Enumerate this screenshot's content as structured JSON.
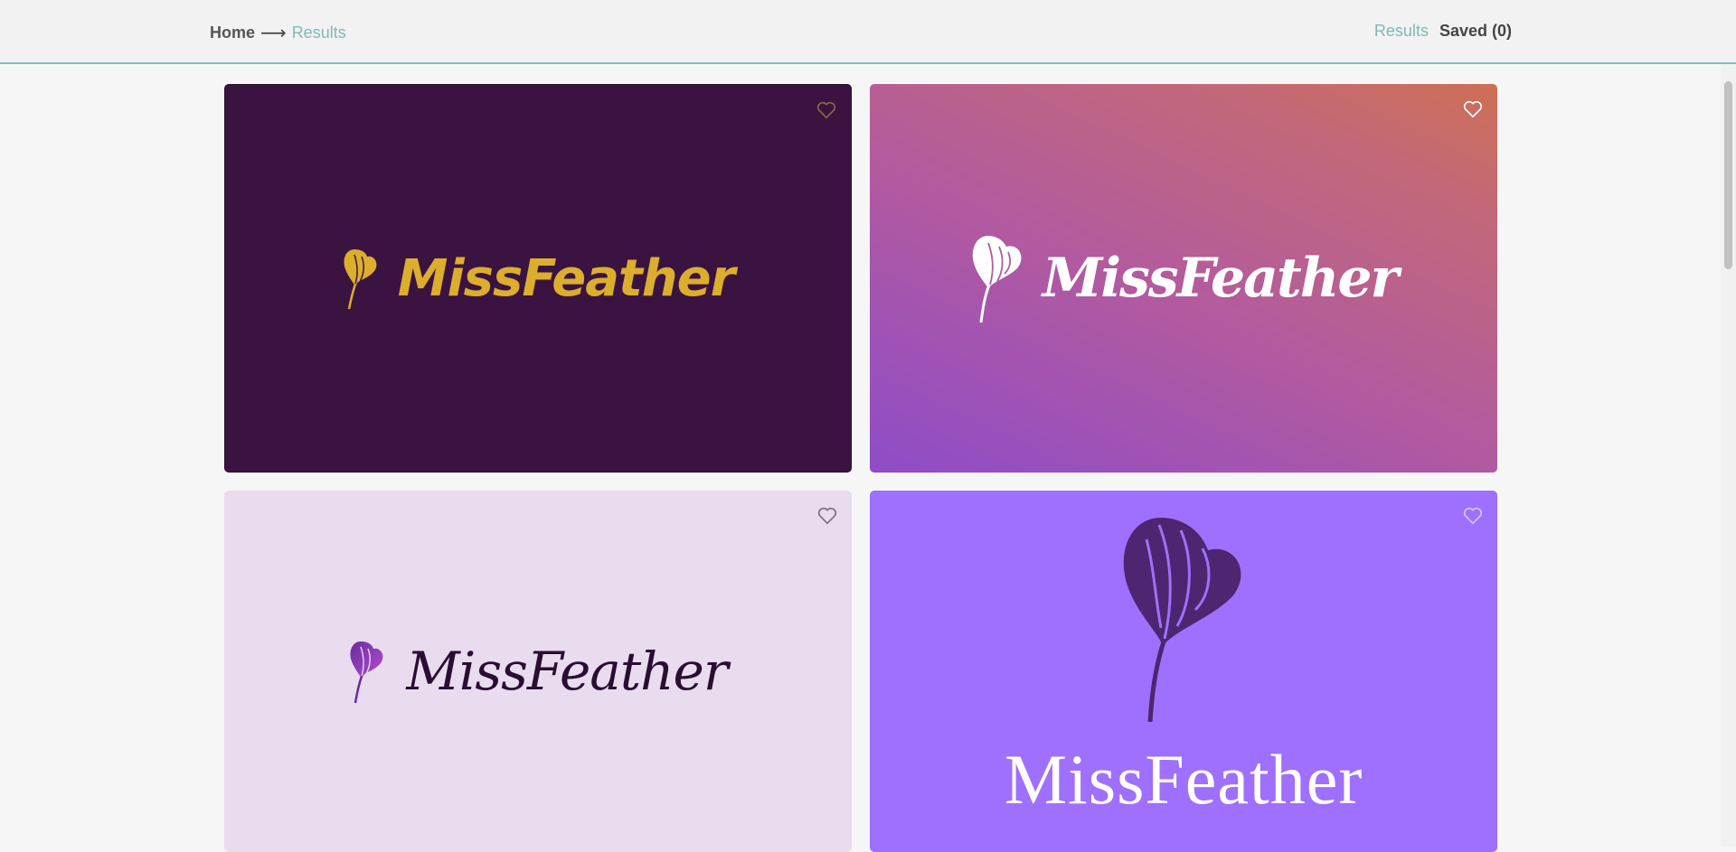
{
  "breadcrumb": {
    "home": "Home",
    "arrow": "⟶",
    "current": "Results"
  },
  "nav": {
    "results": "Results",
    "saved": "Saved (0)"
  },
  "colors": {
    "accent": "#7eb9b6",
    "card1_bg": "#3b1340",
    "card2_bg_from": "#8e4cc8",
    "card2_bg_to": "#cf6f55",
    "card3_bg": "#e8dcee",
    "card4_bg": "#9f70fd"
  },
  "results": [
    {
      "wordmark": "MissFeather",
      "icon": "feather-heart-icon"
    },
    {
      "wordmark": "MissFeather",
      "icon": "feather-heart-icon"
    },
    {
      "wordmark": "MissFeather",
      "icon": "feather-heart-icon"
    },
    {
      "wordmark": "MissFeather",
      "icon": "feather-heart-icon"
    }
  ]
}
